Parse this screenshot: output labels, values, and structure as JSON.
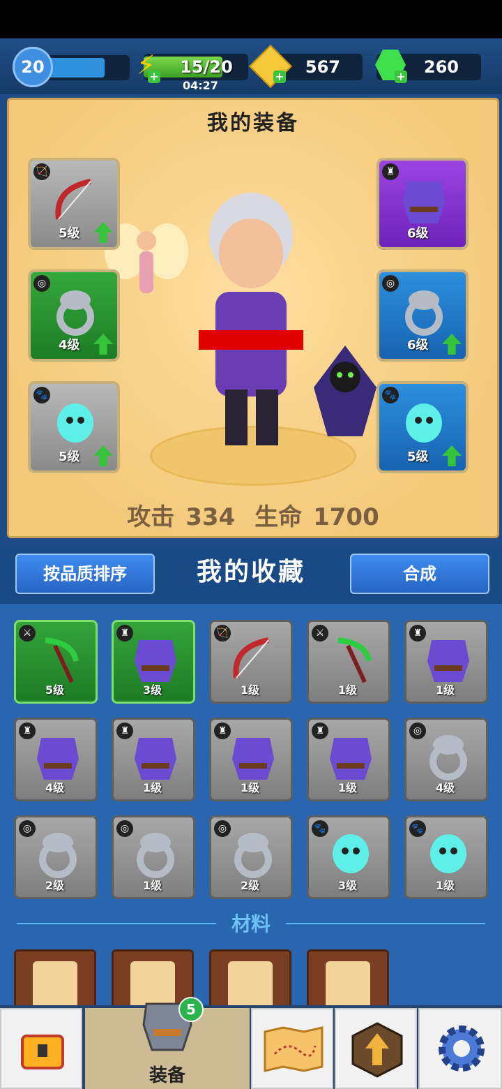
{
  "header": {
    "level": "20",
    "xp_fraction": 0.7,
    "energy": "15/20",
    "energy_fraction": 0.75,
    "energy_timer": "04:27",
    "coins": "567",
    "gems": "260"
  },
  "equipment": {
    "title": "我的装备",
    "left_slots": [
      {
        "type_icon": "bow-icon",
        "level": "5级",
        "rarity": "gray",
        "upgradable": true
      },
      {
        "type_icon": "ring-icon",
        "level": "4级",
        "rarity": "green",
        "upgradable": true
      },
      {
        "type_icon": "pet-icon",
        "level": "5级",
        "rarity": "gray",
        "upgradable": true
      }
    ],
    "right_slots": [
      {
        "type_icon": "armor-icon",
        "level": "6级",
        "rarity": "purple",
        "upgradable": false
      },
      {
        "type_icon": "ring-icon",
        "level": "6级",
        "rarity": "blue",
        "upgradable": true
      },
      {
        "type_icon": "pet-icon",
        "level": "5级",
        "rarity": "blue",
        "upgradable": true
      }
    ],
    "attack_label": "攻击",
    "attack_value": "334",
    "hp_label": "生命",
    "hp_value": "1700"
  },
  "collection": {
    "sort_button": "按品质排序",
    "title": "我的收藏",
    "merge_button": "合成",
    "items": [
      {
        "type_icon": "weapon-icon",
        "level": "5级",
        "rarity": "green"
      },
      {
        "type_icon": "armor-icon",
        "level": "3级",
        "rarity": "green"
      },
      {
        "type_icon": "bow-icon",
        "level": "1级",
        "rarity": "gray"
      },
      {
        "type_icon": "weapon-icon",
        "level": "1级",
        "rarity": "gray"
      },
      {
        "type_icon": "armor-icon",
        "level": "1级",
        "rarity": "gray"
      },
      {
        "type_icon": "armor-icon",
        "level": "4级",
        "rarity": "gray"
      },
      {
        "type_icon": "armor-icon",
        "level": "1级",
        "rarity": "gray"
      },
      {
        "type_icon": "armor-icon",
        "level": "1级",
        "rarity": "gray"
      },
      {
        "type_icon": "armor-icon",
        "level": "1级",
        "rarity": "gray"
      },
      {
        "type_icon": "ring-icon",
        "level": "4级",
        "rarity": "gray"
      },
      {
        "type_icon": "ring-icon",
        "level": "2级",
        "rarity": "gray"
      },
      {
        "type_icon": "ring-icon",
        "level": "1级",
        "rarity": "gray"
      },
      {
        "type_icon": "ring-icon",
        "level": "2级",
        "rarity": "gray"
      },
      {
        "type_icon": "pet-icon",
        "level": "3级",
        "rarity": "gray"
      },
      {
        "type_icon": "pet-icon",
        "level": "1级",
        "rarity": "gray"
      }
    ]
  },
  "materials": {
    "title": "材料",
    "items": [
      "bow-scroll-icon",
      "armor-scroll-icon",
      "ring-scroll-icon",
      "pet-scroll-icon"
    ]
  },
  "nav": {
    "equipment_label": "装备",
    "equipment_badge": "5"
  }
}
